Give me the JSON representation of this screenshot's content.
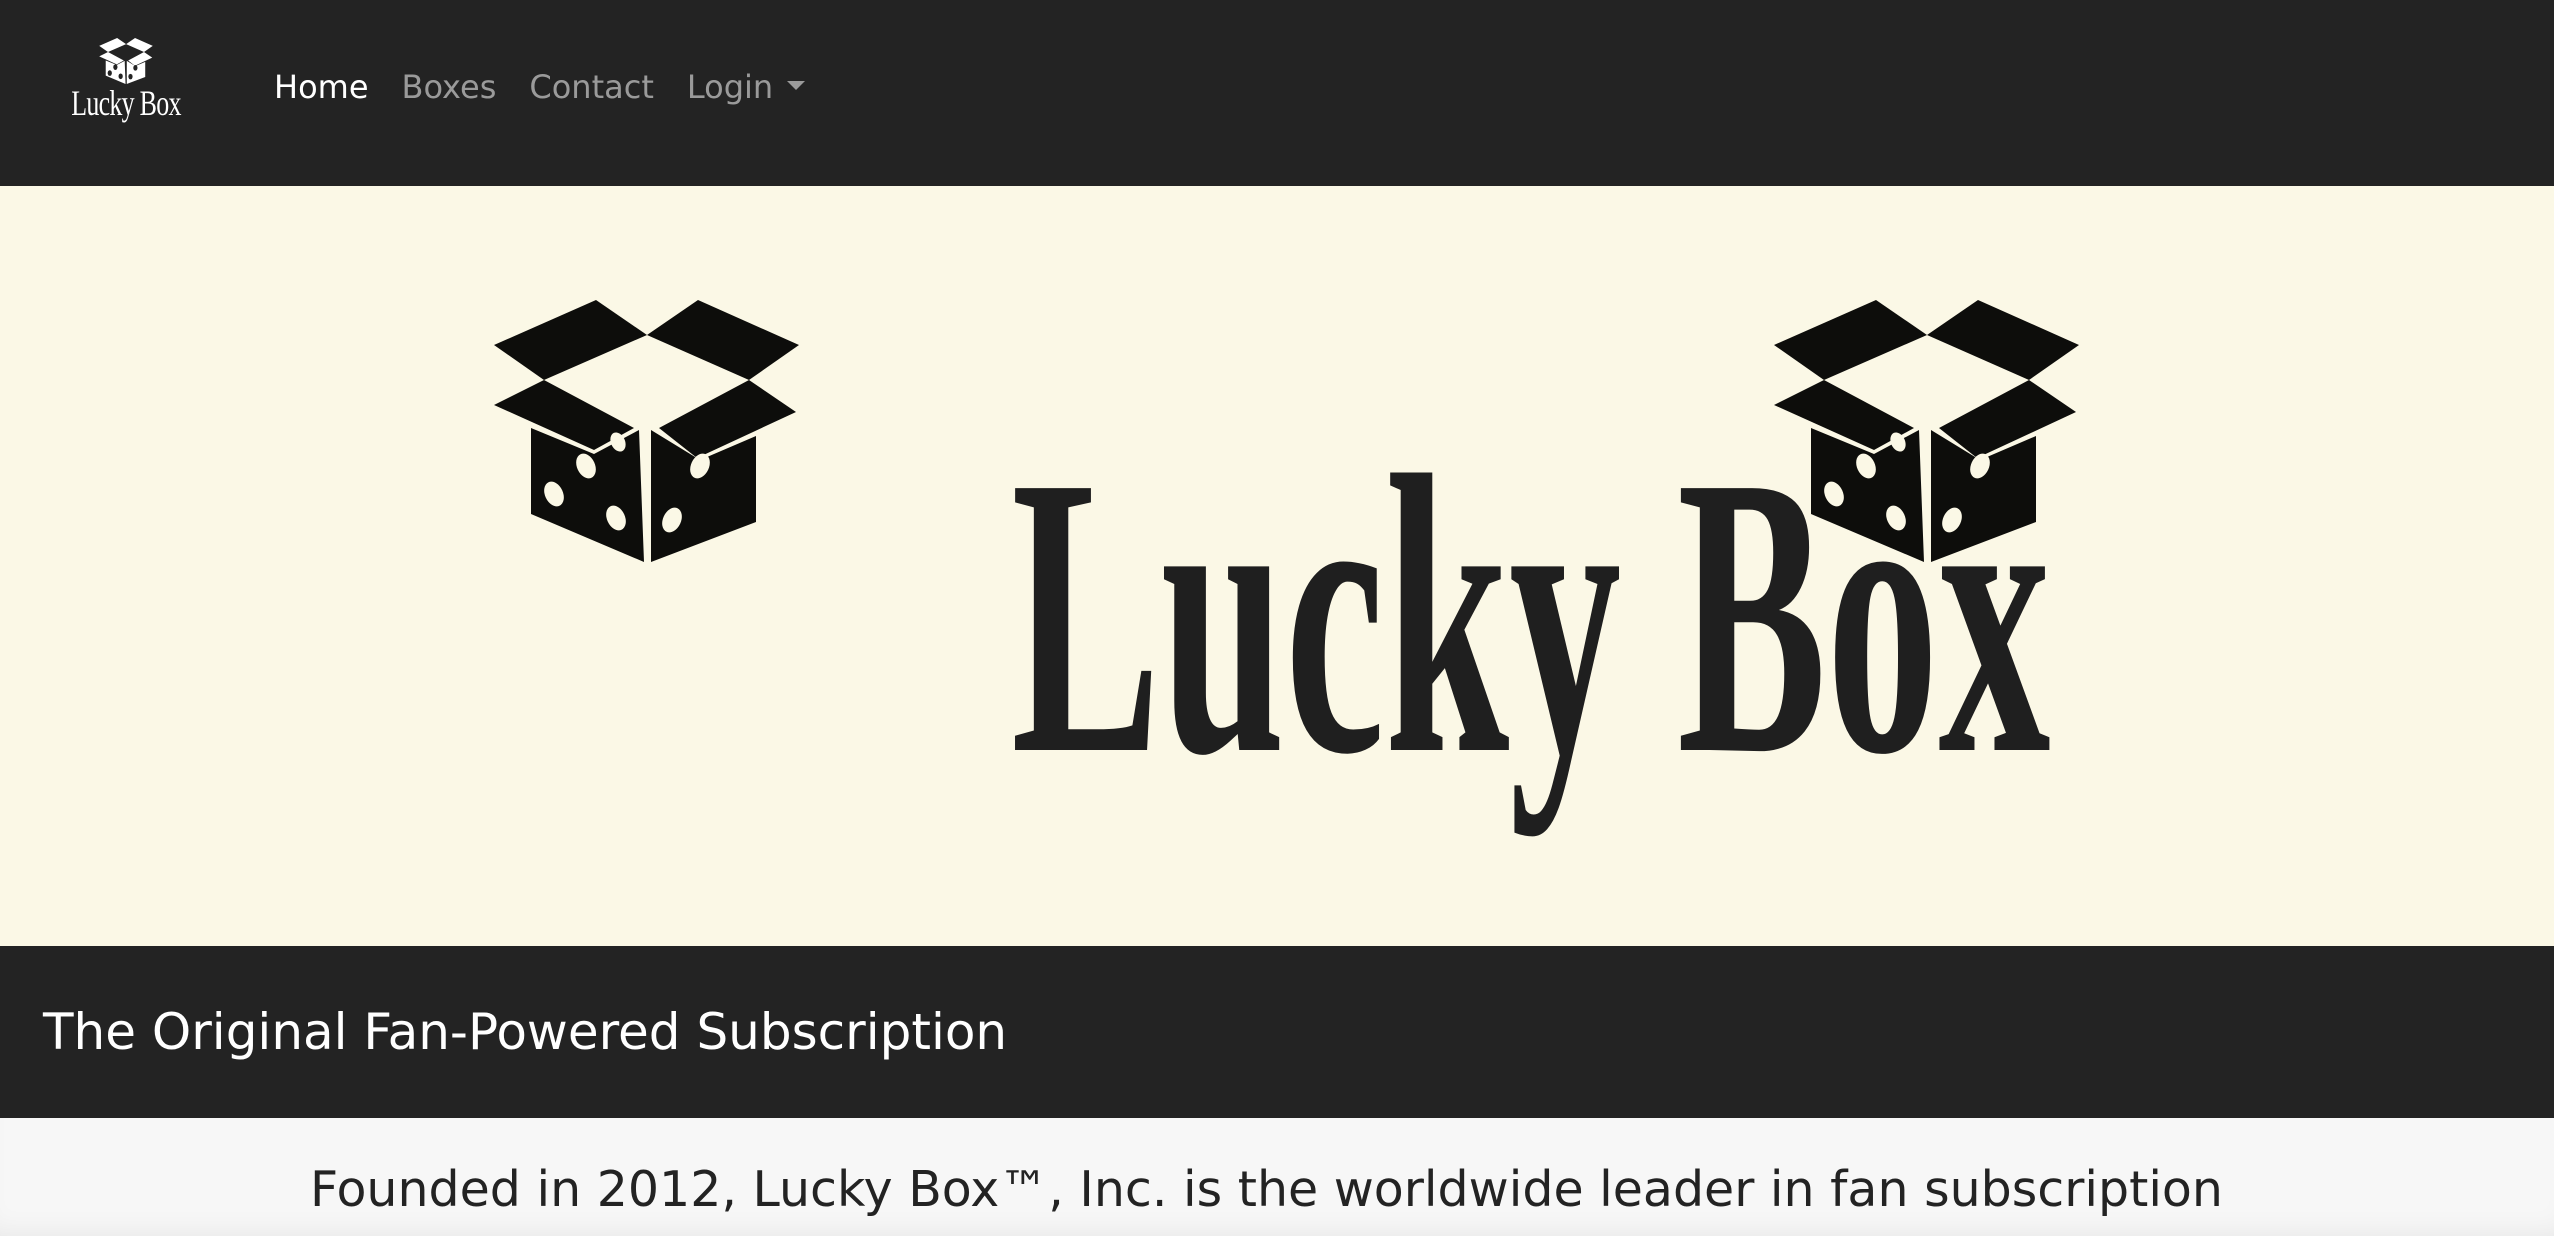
{
  "navbar": {
    "brand_text": "Lucky Box",
    "links": [
      {
        "label": "Home",
        "active": true
      },
      {
        "label": "Boxes",
        "active": false
      },
      {
        "label": "Contact",
        "active": false
      },
      {
        "label": "Login",
        "active": false,
        "dropdown": true
      }
    ]
  },
  "hero": {
    "title": "Lucky Box",
    "icons": [
      "open-box-dice-icon",
      "open-box-dice-icon"
    ]
  },
  "tagline": {
    "text": "The Original Fan-Powered Subscription"
  },
  "about": {
    "text": "Founded in 2012, Lucky Box™, Inc. is the worldwide leader in fan subscription"
  },
  "colors": {
    "navbar_bg": "#232323",
    "hero_bg": "#fbf8e6",
    "nav_active": "#ffffff",
    "nav_inactive": "#9a9a9a",
    "page_bg": "#f7f7f7"
  }
}
